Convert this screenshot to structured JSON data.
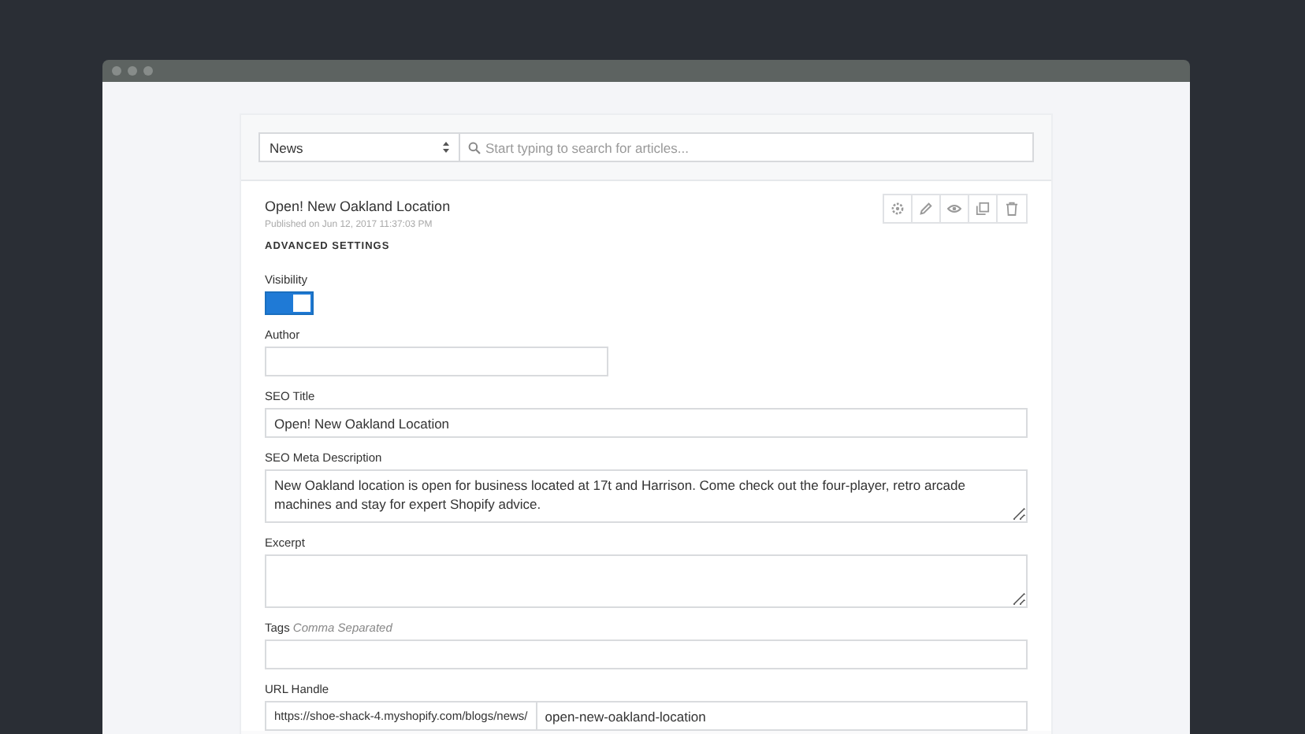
{
  "blog_select": {
    "value": "News"
  },
  "search": {
    "placeholder": "Start typing to search for articles..."
  },
  "article": {
    "title": "Open! New Oakland Location",
    "published": "Published on Jun 12, 2017 11:37:03 PM"
  },
  "section_heading": "ADVANCED SETTINGS",
  "visibility": {
    "label": "Visibility",
    "on": true
  },
  "fields": [
    {
      "kind": "short",
      "label": "Author"
    },
    {
      "kind": "text",
      "label": "SEO Title",
      "value": "Open! New Oakland Location"
    },
    {
      "kind": "textarea",
      "label": "SEO Meta Description",
      "value": "New Oakland location is open for business located at 17t and Harrison. Come check out the four-player, retro arcade machines and stay for expert Shopify advice."
    },
    {
      "kind": "textarea",
      "label": "Excerpt"
    },
    {
      "kind": "text",
      "label": "Tags",
      "hint": "Comma Separated"
    },
    {
      "kind": "url",
      "label": "URL Handle",
      "prefix": "https://shoe-shack-4.myshopify.com/blogs/news/",
      "value": "open-new-oakland-location"
    }
  ]
}
